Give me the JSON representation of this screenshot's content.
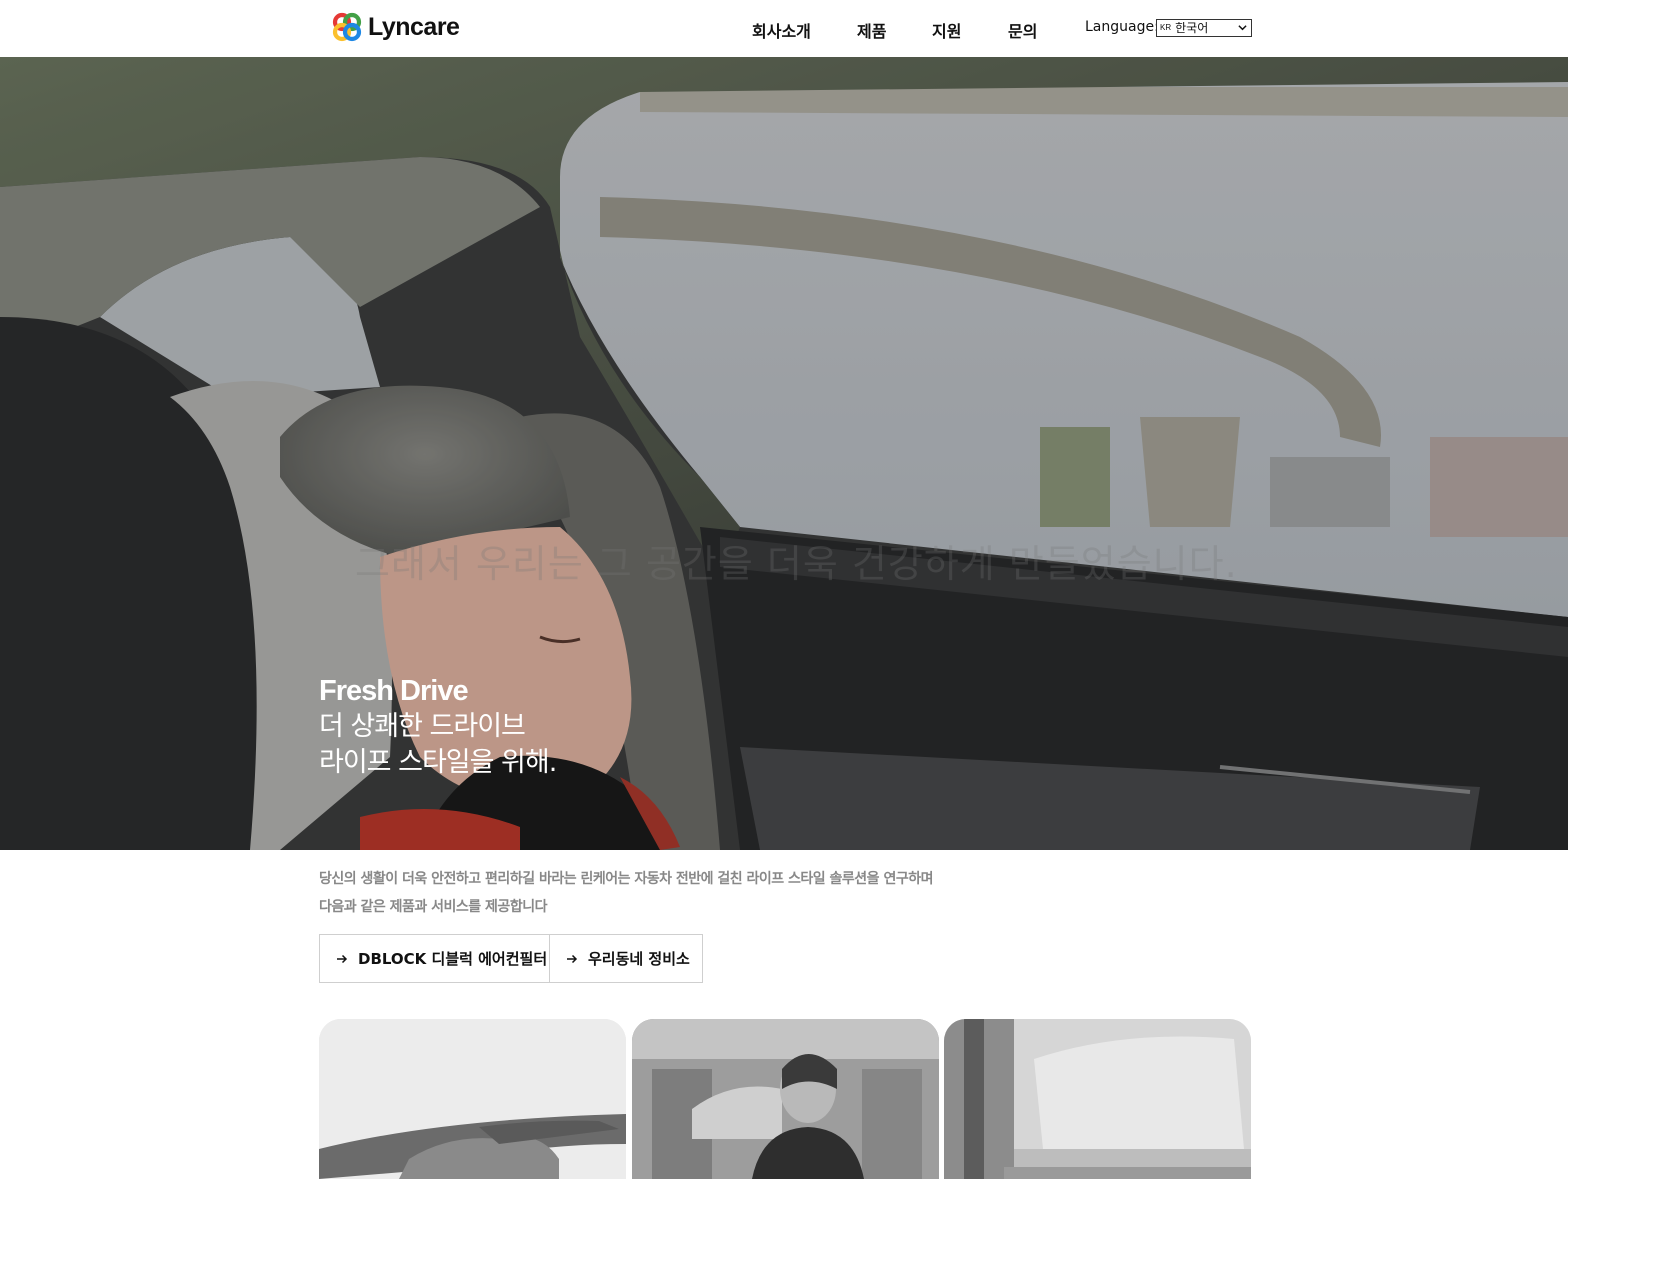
{
  "header": {
    "logo_text": "Lyncare",
    "nav": [
      "회사소개",
      "제품",
      "지원",
      "문의"
    ],
    "language_label": "Language:",
    "language_flag": "KR",
    "language_value": "한국어"
  },
  "hero": {
    "ghost_text": "그래서 우리는 그 공간을 더욱 건강하게 만들었습니다.",
    "title_en": "Fresh Drive",
    "title_line2": "더 상쾌한 드라이브",
    "title_line3": "라이프 스타일을 위해."
  },
  "intro": {
    "line1": "당신의 생활이 더욱 안전하고 편리하길 바라는 린케어는 자동차 전반에 걸친 라이프 스타일 솔루션을 연구하며",
    "line2": "다음과 같은 제품과 서비스를 제공합니다"
  },
  "buttons": {
    "dblock": "DBLOCK 디블럭 에어컨필터",
    "garage": "우리동네 정비소"
  },
  "icons": [
    "logo-icon",
    "chevron-down-icon",
    "arrow-right-icon"
  ]
}
